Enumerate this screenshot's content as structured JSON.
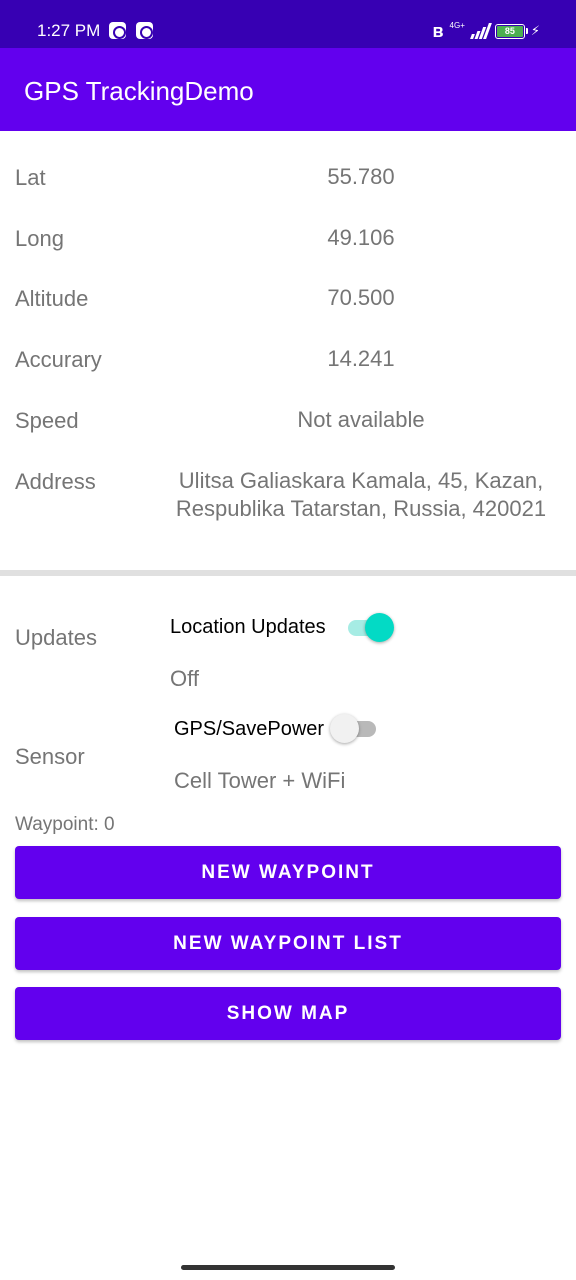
{
  "status_bar": {
    "time": "1:27 PM",
    "notification_icons": [
      "app-notification-icon",
      "app-notification-icon"
    ],
    "network_type": "4G+",
    "battery_level": "85",
    "icons": [
      "bluetooth-icon",
      "signal-icon",
      "battery-icon",
      "charging-icon"
    ]
  },
  "app_bar": {
    "title": "GPS TrackingDemo"
  },
  "location": {
    "rows": [
      {
        "label": "Lat",
        "value": "55.780"
      },
      {
        "label": "Long",
        "value": "49.106"
      },
      {
        "label": "Altitude",
        "value": "70.500"
      },
      {
        "label": "Accurary",
        "value": "14.241"
      },
      {
        "label": "Speed",
        "value": "Not available"
      },
      {
        "label": "Address",
        "value_line1": "Ulitsa Galiaskara Kamala, 45, Kazan,",
        "value_line2": "Respublika Tatarstan, Russia, 420021"
      }
    ]
  },
  "updates": {
    "label": "Updates",
    "switch_label": "Location Updates",
    "switch_on": true,
    "status": "Off"
  },
  "sensor": {
    "label": "Sensor",
    "switch_label": "GPS/SavePower",
    "switch_on": false,
    "status": "Cell Tower + WiFi"
  },
  "waypoints": {
    "count_text": "Waypoint: 0"
  },
  "buttons": {
    "new_waypoint": "NEW WAYPOINT",
    "new_waypoint_list": "NEW WAYPOINT LIST",
    "show_map": "SHOW MAP"
  },
  "colors": {
    "status_bar": "#3700b3",
    "primary": "#6200ee",
    "accent": "#03dac5",
    "text_secondary": "#757575"
  }
}
